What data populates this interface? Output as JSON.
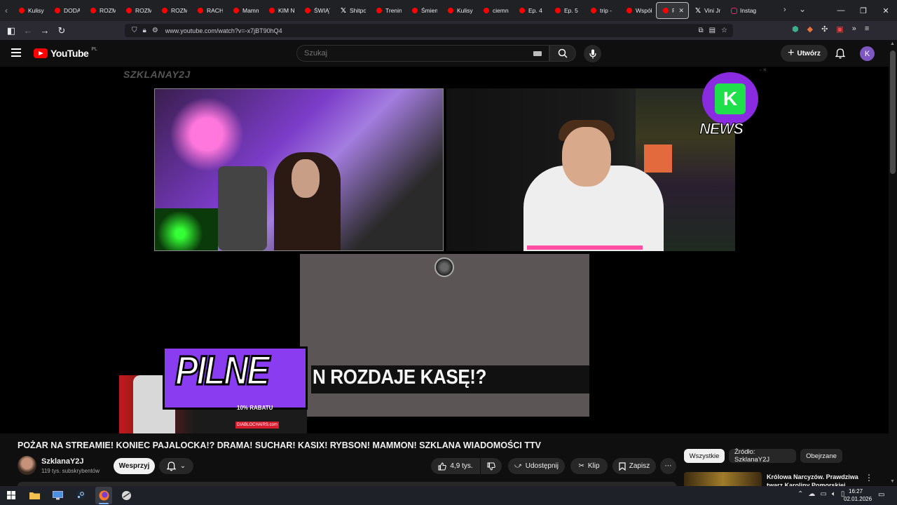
{
  "browser": {
    "tabs": [
      {
        "label": "Kulisy",
        "icon": "youtube-icon"
      },
      {
        "label": "DODA",
        "icon": "youtube-icon"
      },
      {
        "label": "ROZM",
        "icon": "youtube-icon"
      },
      {
        "label": "ROZM",
        "icon": "youtube-icon"
      },
      {
        "label": "ROZM",
        "icon": "youtube-icon"
      },
      {
        "label": "RACH",
        "icon": "youtube-icon"
      },
      {
        "label": "Mamm",
        "icon": "youtube-icon"
      },
      {
        "label": "KIM N",
        "icon": "youtube-icon"
      },
      {
        "label": "ŚWIĄT",
        "icon": "youtube-icon"
      },
      {
        "label": "Shitpo",
        "icon": "x-icon"
      },
      {
        "label": "Trenin",
        "icon": "youtube-icon"
      },
      {
        "label": "Śmiem",
        "icon": "youtube-icon"
      },
      {
        "label": "Kulisy",
        "icon": "youtube-icon"
      },
      {
        "label": "ciemn",
        "icon": "youtube-icon"
      },
      {
        "label": "Ep. 4",
        "icon": "youtube-icon"
      },
      {
        "label": "Ep. 5",
        "icon": "youtube-icon"
      },
      {
        "label": "trip -",
        "icon": "youtube-icon"
      },
      {
        "label": "Współ",
        "icon": "youtube-icon"
      },
      {
        "label": "PO",
        "icon": "youtube-icon",
        "active": true
      },
      {
        "label": "Vini Jr.",
        "icon": "x-icon"
      },
      {
        "label": "Instag",
        "icon": "instagram-icon"
      }
    ],
    "url": "www.youtube.com/watch?v=-x7jBT90hQ4"
  },
  "youtube": {
    "logo_text": "YouTube",
    "country": "PL",
    "search_placeholder": "Szukaj",
    "create_label": "Utwórz",
    "avatar_letter": "K"
  },
  "player": {
    "channel_overlay": "SZKLANAY2J",
    "news_label": "NEWS",
    "pilne_label": "PILNE",
    "headline": "N ROZDAJE KASĘ!?",
    "sponsor_discount": "10% RABATU",
    "sponsor_brand": "DIABLOCHAIRS.com"
  },
  "video": {
    "title": "POŻAR NA STREAMIE! KONIEC PAJALOCKA!? DRAMA! SUCHAR! KASIX! RYBSON! MAMMON! SZKLANA WIADOMOŚCI TTV",
    "channel_name": "SzklanaY2J",
    "subscribers": "119 tys. subskrybentów",
    "support_label": "Wesprzyj",
    "likes": "4,9 tys.",
    "share_label": "Udostępnij",
    "clip_label": "Klip",
    "save_label": "Zapisz"
  },
  "sidebar": {
    "chips": [
      "Wszystkie",
      "Źródło: SzklanaY2J",
      "Obejrzane"
    ],
    "active_chip": "Wszystkie",
    "recommended_title": "Królowa Narcyzów. Prawdziwa twarz Karoliny Pomorskiej"
  },
  "taskbar": {
    "time": "16:27",
    "date": "02.01.2026"
  },
  "colors": {
    "youtube_red": "#ff0000",
    "background": "#0f0f0f",
    "pilne_purple": "#8a3cf0",
    "avatar_purple": "#7e57c2"
  }
}
